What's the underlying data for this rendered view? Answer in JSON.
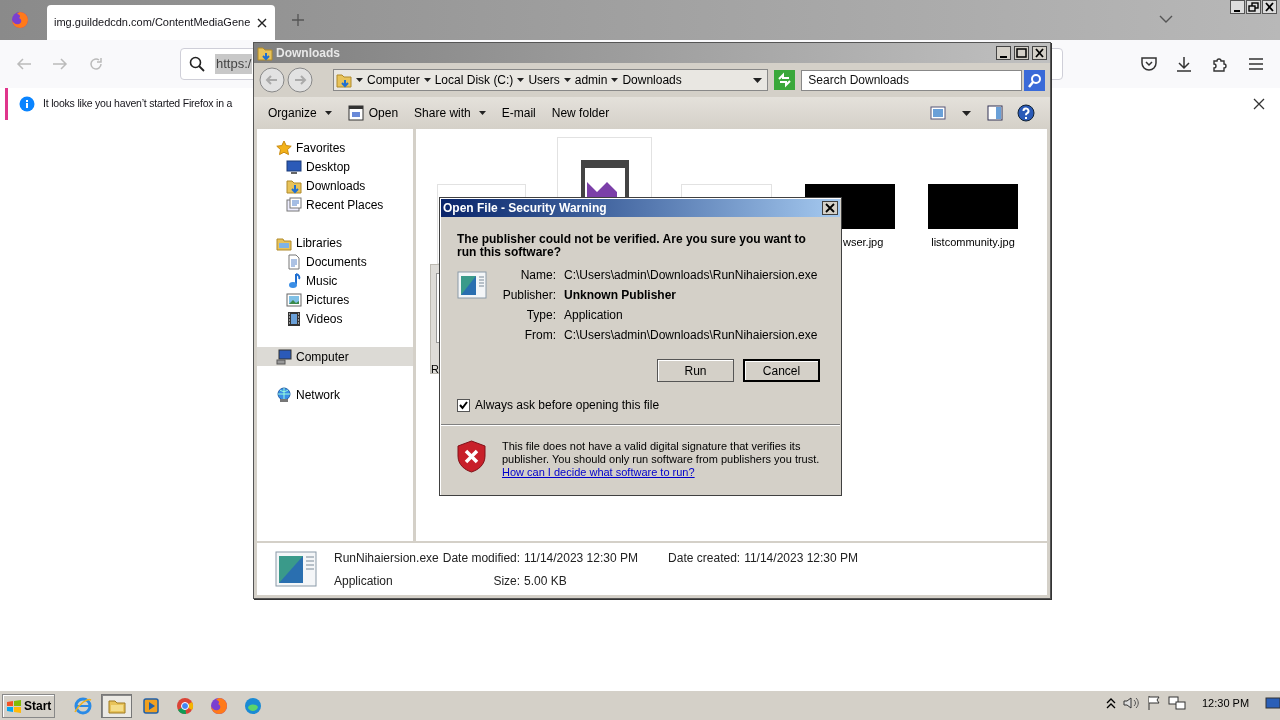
{
  "browser": {
    "tab": {
      "title": "img.guildedcdn.com/ContentMediaGene",
      "selected": true
    },
    "url_bar": {
      "value": "https:/"
    },
    "notification": {
      "text": "It looks like you haven’t started Firefox in a"
    }
  },
  "explorer": {
    "title": "Downloads",
    "breadcrumb": [
      "Computer",
      "Local Disk (C:)",
      "Users",
      "admin",
      "Downloads"
    ],
    "search": {
      "placeholder": "Search Downloads"
    },
    "toolbar": [
      {
        "label": "Organize",
        "kind": "menu"
      },
      {
        "label": "Open",
        "kind": "open"
      },
      {
        "label": "Share with",
        "kind": "menu"
      },
      {
        "label": "E-mail",
        "kind": "plain"
      },
      {
        "label": "New folder",
        "kind": "plain"
      }
    ],
    "nav": [
      {
        "label": "Favorites",
        "kind": "star",
        "selected": false,
        "children": [
          {
            "label": "Desktop",
            "kind": "desktop",
            "selected": false
          },
          {
            "label": "Downloads",
            "kind": "downloads",
            "selected": false
          },
          {
            "label": "Recent Places",
            "kind": "recent",
            "selected": false
          }
        ]
      },
      {
        "label": "Libraries",
        "kind": "libraries",
        "selected": false,
        "children": [
          {
            "label": "Documents",
            "kind": "documents",
            "selected": false
          },
          {
            "label": "Music",
            "kind": "music",
            "selected": false
          },
          {
            "label": "Pictures",
            "kind": "pictures",
            "selected": false
          },
          {
            "label": "Videos",
            "kind": "videos",
            "selected": false
          }
        ]
      },
      {
        "label": "Computer",
        "kind": "computer",
        "selected": true
      },
      {
        "label": "Network",
        "kind": "network",
        "selected": false
      }
    ],
    "files": [
      {
        "kind": "light",
        "selected": false
      },
      {
        "kind": "icon",
        "selected": false
      },
      {
        "kind": "light",
        "selected": false
      },
      {
        "kind": "dark",
        "label": "wser.jpg",
        "selected": false
      },
      {
        "kind": "dark",
        "label": "listcommunity.jpg",
        "selected": false
      },
      {
        "kind": "partial",
        "label": "R",
        "selected": true
      }
    ],
    "details": {
      "name": "RunNihaiersion.exe",
      "type": "Application",
      "fields": [
        {
          "label": "Date modified:",
          "value": "11/14/2023 12:30 PM"
        },
        {
          "label": "Date created:",
          "value": "11/14/2023 12:30 PM"
        },
        {
          "label": "Size:",
          "value": "5.00 KB"
        }
      ]
    }
  },
  "dialog": {
    "title": "Open File - Security Warning",
    "heading": "The publisher could not be verified. Are you sure you want to run this software?",
    "fields": [
      {
        "label": "Name:",
        "value": "C:\\Users\\admin\\Downloads\\RunNihaiersion.exe",
        "bold": false
      },
      {
        "label": "Publisher:",
        "value": "Unknown Publisher",
        "bold": true
      },
      {
        "label": "Type:",
        "value": "Application",
        "bold": false
      },
      {
        "label": "From:",
        "value": "C:\\Users\\admin\\Downloads\\RunNihaiersion.exe",
        "bold": false
      }
    ],
    "buttons": [
      {
        "label": "Run",
        "default": false
      },
      {
        "label": "Cancel",
        "default": true
      }
    ],
    "checkbox": {
      "label": "Always ask before opening this file",
      "checked": true
    },
    "warning": "This file does not have a valid digital signature that verifies its publisher. You should only run software from publishers you trust.",
    "link": "How can I decide what software to run?"
  },
  "taskbar": {
    "start": "Start",
    "apps": [
      {
        "kind": "ie",
        "active": false
      },
      {
        "kind": "explorer",
        "active": true
      },
      {
        "kind": "media",
        "active": false
      },
      {
        "kind": "chrome",
        "active": false
      },
      {
        "kind": "firefox",
        "active": false
      },
      {
        "kind": "edge",
        "active": false
      }
    ],
    "clock": "12:30 PM"
  }
}
